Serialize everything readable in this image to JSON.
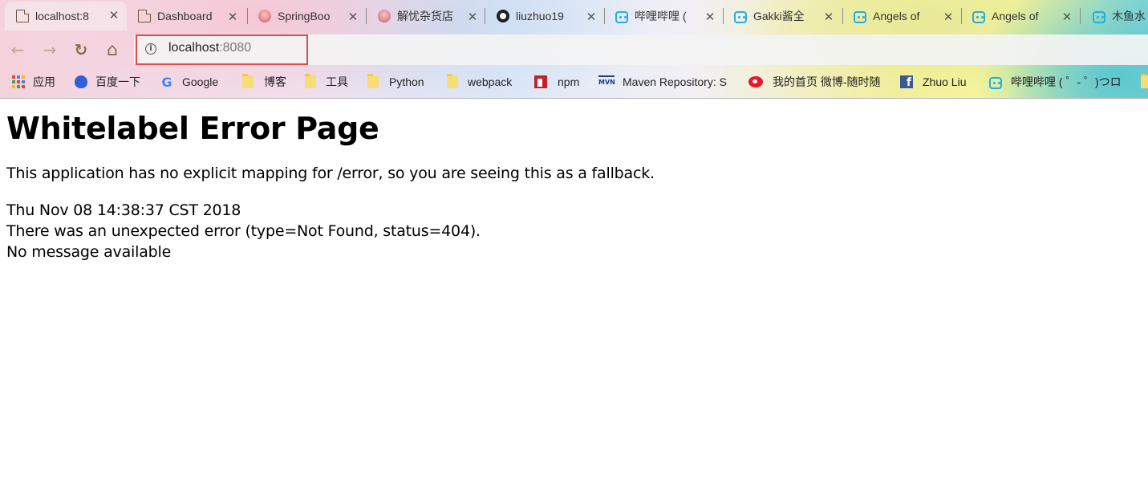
{
  "tabs": [
    {
      "title": "localhost:8",
      "icon": "page-icon",
      "active": true
    },
    {
      "title": "Dashboard",
      "icon": "page-icon",
      "active": false
    },
    {
      "title": "SpringBoo",
      "icon": "anime-avatar-icon",
      "active": false
    },
    {
      "title": "解忧杂货店",
      "icon": "anime-avatar-icon",
      "active": false
    },
    {
      "title": "liuzhuo19",
      "icon": "github-icon",
      "active": false
    },
    {
      "title": "哔哩哔哩 (",
      "icon": "bilibili-icon",
      "active": false
    },
    {
      "title": "Gakki酱全",
      "icon": "bilibili-icon",
      "active": false
    },
    {
      "title": "Angels of",
      "icon": "bilibili-icon",
      "active": false
    },
    {
      "title": "Angels of",
      "icon": "bilibili-icon",
      "active": false
    },
    {
      "title": "木鱼水",
      "icon": "bilibili-icon",
      "active": false
    }
  ],
  "tab_close_glyph": "✕",
  "toolbar": {
    "back_glyph": "←",
    "forward_glyph": "→",
    "reload_glyph": "↻",
    "home_glyph": "⌂",
    "info_glyph": "i"
  },
  "omnibox": {
    "host": "localhost",
    "port": ":8080"
  },
  "bookmarks": [
    {
      "label": "应用",
      "icon": "apps-icon"
    },
    {
      "label": "百度一下",
      "icon": "baidu-icon"
    },
    {
      "label": "Google",
      "icon": "google-icon"
    },
    {
      "label": "博客",
      "icon": "folder-icon"
    },
    {
      "label": "工具",
      "icon": "folder-icon"
    },
    {
      "label": "Python",
      "icon": "folder-icon"
    },
    {
      "label": "webpack",
      "icon": "folder-icon"
    },
    {
      "label": "npm",
      "icon": "npm-icon"
    },
    {
      "label": "Maven Repository: S",
      "icon": "maven-icon"
    },
    {
      "label": "我的首页 微博-随时随",
      "icon": "weibo-icon"
    },
    {
      "label": "Zhuo Liu",
      "icon": "facebook-icon"
    },
    {
      "label": "哔哩哔哩 ( ゜- ゜)つロ",
      "icon": "bilibili-icon"
    }
  ],
  "page": {
    "heading": "Whitelabel Error Page",
    "description": "This application has no explicit mapping for /error, so you are seeing this as a fallback.",
    "timestamp": "Thu Nov 08 14:38:37 CST 2018",
    "error_line": "There was an unexpected error (type=Not Found, status=404).",
    "message": "No message available"
  },
  "colors": {
    "highlight_box": "#e54b4b",
    "bilibili": "#23ade5",
    "npm": "#c12127",
    "facebook": "#3b5998"
  }
}
